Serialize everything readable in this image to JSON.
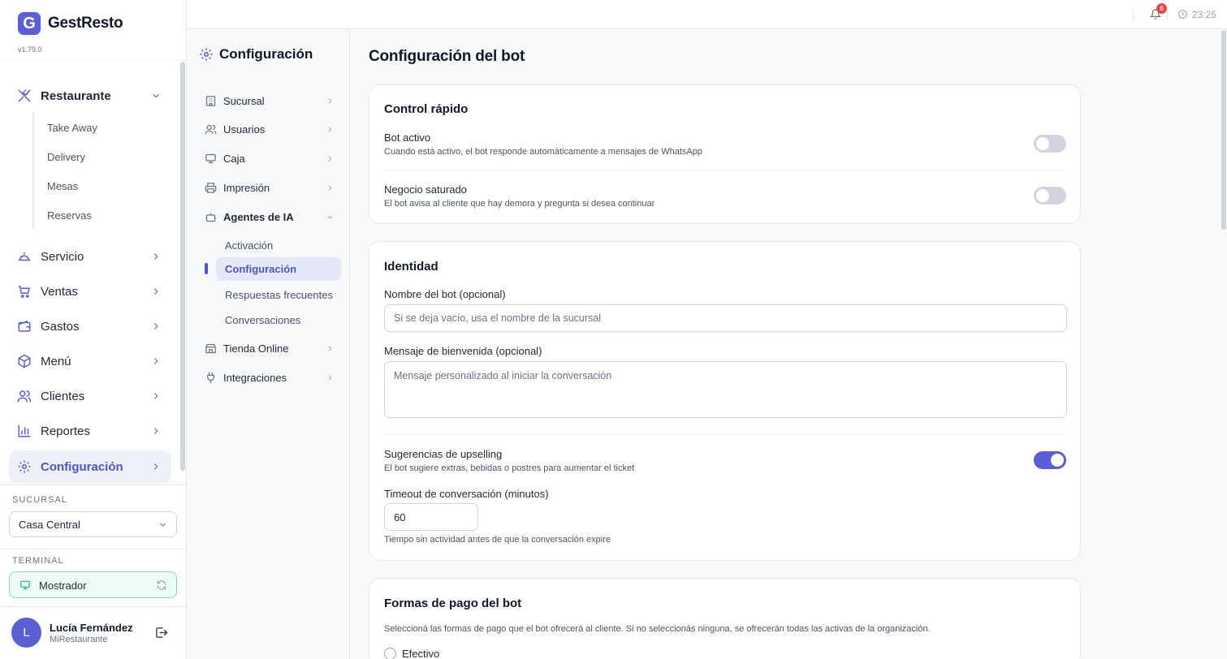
{
  "app": {
    "name": "GestResto",
    "logo_letter": "G",
    "version": "v1.79.0"
  },
  "sidebar": {
    "restaurant": {
      "label": "Restaurante",
      "subitems": [
        "Take Away",
        "Delivery",
        "Mesas",
        "Reservas"
      ]
    },
    "items": [
      {
        "label": "Servicio",
        "icon": "service-bell-icon"
      },
      {
        "label": "Ventas",
        "icon": "cart-icon"
      },
      {
        "label": "Gastos",
        "icon": "wallet-icon"
      },
      {
        "label": "Menú",
        "icon": "package-icon"
      },
      {
        "label": "Clientes",
        "icon": "users-icon"
      },
      {
        "label": "Reportes",
        "icon": "bar-chart-icon"
      },
      {
        "label": "Configuración",
        "icon": "gear-icon",
        "active": true
      }
    ],
    "branch_label": "SUCURSAL",
    "branch_value": "Casa Central",
    "terminal_label": "TERMINAL",
    "terminal_value": "Mostrador",
    "user": {
      "initial": "L",
      "name": "Lucía Fernández",
      "org": "MiRestaurante"
    }
  },
  "topbar": {
    "notifications": "6",
    "time": "23:25"
  },
  "config_nav": {
    "title": "Configuración",
    "items": [
      {
        "label": "Sucursal"
      },
      {
        "label": "Usuarios"
      },
      {
        "label": "Caja"
      },
      {
        "label": "Impresión"
      },
      {
        "label": "Agentes de IA",
        "expanded": true
      },
      {
        "label": "Tienda Online"
      },
      {
        "label": "Integraciones"
      }
    ],
    "ai_subitems": [
      "Activación",
      "Configuración",
      "Respuestas frecuentes",
      "Conversaciones"
    ],
    "active_subitem": "Configuración"
  },
  "page": {
    "title": "Configuración del bot",
    "quick": {
      "title": "Control rápido",
      "bot_active": {
        "label": "Bot activo",
        "desc": "Cuando está activo, el bot responde automáticamente a mensajes de WhatsApp",
        "on": false
      },
      "saturated": {
        "label": "Negocio saturado",
        "desc": "El bot avisa al cliente que hay demora y pregunta si desea continuar",
        "on": false
      }
    },
    "identity": {
      "title": "Identidad",
      "name_label": "Nombre del bot (opcional)",
      "name_placeholder": "Si se deja vacío, usa el nombre de la sucursal",
      "welcome_label": "Mensaje de bienvenida (opcional)",
      "welcome_placeholder": "Mensaje personalizado al iniciar la conversación",
      "upselling": {
        "label": "Sugerencias de upselling",
        "desc": "El bot sugiere extras, bebidas o postres para aumentar el ticket",
        "on": true
      },
      "timeout_label": "Timeout de conversación (minutos)",
      "timeout_value": "60",
      "timeout_hint": "Tiempo sin actividad antes de que la conversación expire"
    },
    "payments": {
      "title": "Formas de pago del bot",
      "desc": "Seleccioná las formas de pago que el bot ofrecerá al cliente. Si no seleccionás ninguna, se ofrecerán todas las activas de la organización.",
      "options": [
        "Efectivo"
      ]
    }
  },
  "colors": {
    "accent": "#5b5fd6",
    "terminal_bg": "#effbf5",
    "badge": "#ef4444"
  }
}
